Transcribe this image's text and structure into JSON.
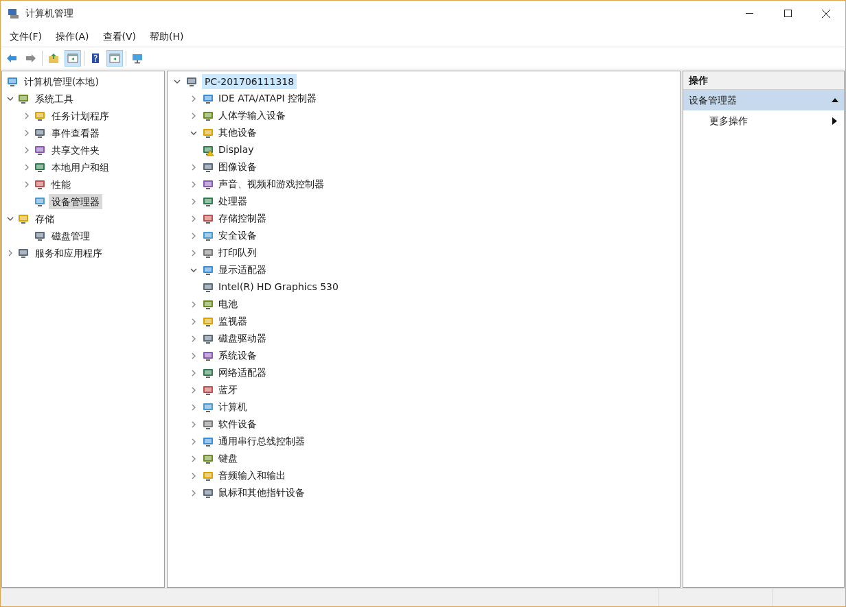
{
  "window": {
    "title": "计算机管理"
  },
  "menu": [
    "文件(F)",
    "操作(A)",
    "查看(V)",
    "帮助(H)"
  ],
  "toolbar": [
    {
      "pressed": false
    },
    {
      "pressed": false
    },
    {
      "pressed": false
    },
    {
      "pressed": true
    },
    {
      "pressed": false
    },
    {
      "pressed": true
    },
    {
      "pressed": false
    }
  ],
  "nav_tree": [
    {
      "label": "计算机管理(本地)",
      "kind": "root",
      "selected": false,
      "children": [
        {
          "label": "系统工具",
          "kind": "node",
          "expanded": true,
          "selected": false,
          "children": [
            {
              "label": "任务计划程序",
              "kind": "node",
              "expanded": false,
              "selected": false
            },
            {
              "label": "事件查看器",
              "kind": "node",
              "expanded": false,
              "selected": false
            },
            {
              "label": "共享文件夹",
              "kind": "node",
              "expanded": false,
              "selected": false
            },
            {
              "label": "本地用户和组",
              "kind": "node",
              "expanded": false,
              "selected": false
            },
            {
              "label": "性能",
              "kind": "node",
              "expanded": false,
              "selected": false
            },
            {
              "label": "设备管理器",
              "kind": "leaf",
              "selected": true
            }
          ]
        },
        {
          "label": "存储",
          "kind": "node",
          "expanded": true,
          "selected": false,
          "children": [
            {
              "label": "磁盘管理",
              "kind": "leaf",
              "selected": false
            }
          ]
        },
        {
          "label": "服务和应用程序",
          "kind": "node",
          "expanded": false,
          "selected": false
        }
      ]
    }
  ],
  "device_tree": {
    "label": "PC-201706111318",
    "expanded": true,
    "selected": true,
    "children": [
      {
        "label": "IDE ATA/ATAPI 控制器",
        "kind": "category",
        "expanded": false
      },
      {
        "label": "人体学输入设备",
        "kind": "category",
        "expanded": false
      },
      {
        "label": "其他设备",
        "kind": "category",
        "expanded": true,
        "children": [
          {
            "label": "Display",
            "kind": "device",
            "warning": true
          }
        ]
      },
      {
        "label": "图像设备",
        "kind": "category",
        "expanded": false
      },
      {
        "label": "声音、视频和游戏控制器",
        "kind": "category",
        "expanded": false
      },
      {
        "label": "处理器",
        "kind": "category",
        "expanded": false
      },
      {
        "label": "存储控制器",
        "kind": "category",
        "expanded": false
      },
      {
        "label": "安全设备",
        "kind": "category",
        "expanded": false
      },
      {
        "label": "打印队列",
        "kind": "category",
        "expanded": false
      },
      {
        "label": "显示适配器",
        "kind": "category",
        "expanded": true,
        "children": [
          {
            "label": "Intel(R) HD Graphics 530",
            "kind": "device",
            "warning": false
          }
        ]
      },
      {
        "label": "电池",
        "kind": "category",
        "expanded": false
      },
      {
        "label": "监视器",
        "kind": "category",
        "expanded": false
      },
      {
        "label": "磁盘驱动器",
        "kind": "category",
        "expanded": false
      },
      {
        "label": "系统设备",
        "kind": "category",
        "expanded": false
      },
      {
        "label": "网络适配器",
        "kind": "category",
        "expanded": false
      },
      {
        "label": "蓝牙",
        "kind": "category",
        "expanded": false
      },
      {
        "label": "计算机",
        "kind": "category",
        "expanded": false
      },
      {
        "label": "软件设备",
        "kind": "category",
        "expanded": false
      },
      {
        "label": "通用串行总线控制器",
        "kind": "category",
        "expanded": false
      },
      {
        "label": "键盘",
        "kind": "category",
        "expanded": false
      },
      {
        "label": "音频输入和输出",
        "kind": "category",
        "expanded": false
      },
      {
        "label": "鼠标和其他指针设备",
        "kind": "category",
        "expanded": false
      }
    ]
  },
  "actions": {
    "title": "操作",
    "section": {
      "label": "设备管理器",
      "expanded": true
    },
    "items": [
      "更多操作"
    ]
  }
}
